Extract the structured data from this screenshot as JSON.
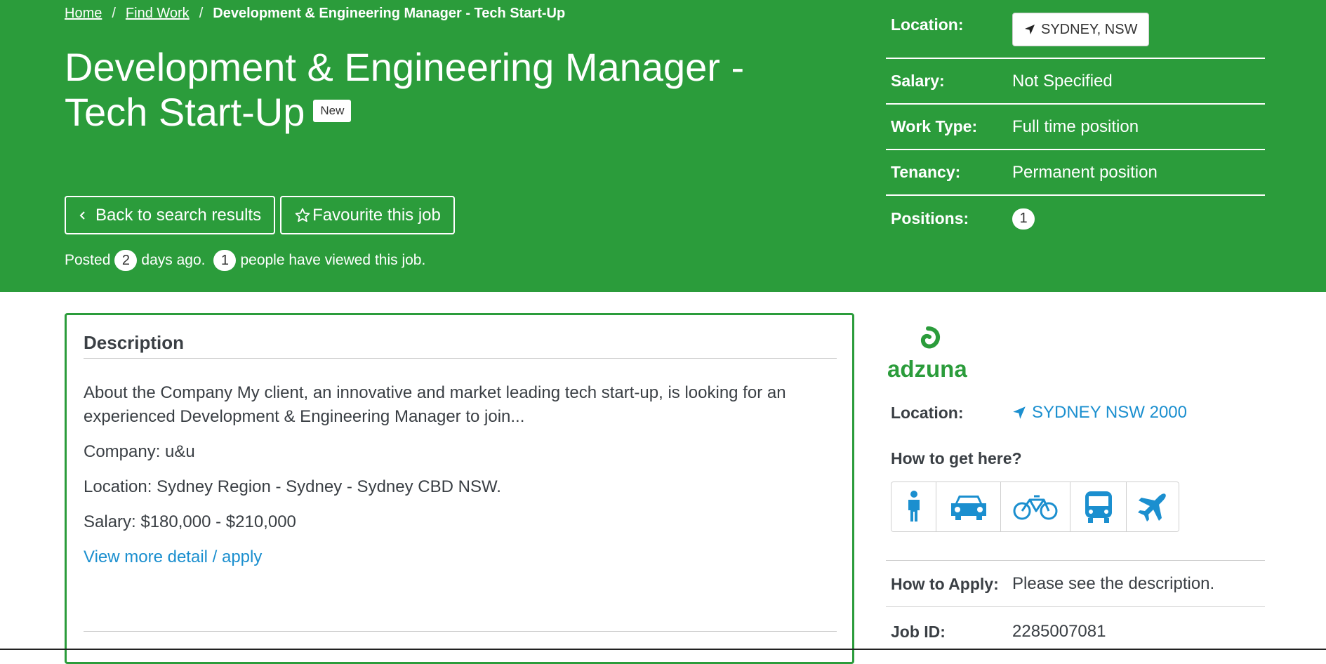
{
  "breadcrumb": {
    "home": "Home",
    "find_work": "Find Work",
    "current": "Development & Engineering Manager - Tech Start-Up",
    "separator": "/"
  },
  "job": {
    "title": "Development & Engineering Manager - Tech Start-Up",
    "badge": "New"
  },
  "buttons": {
    "back": "Back to search results",
    "favourite": "Favourite this job"
  },
  "posted": {
    "prefix": "Posted",
    "days": "2",
    "days_suffix": "days ago.",
    "views": "1",
    "views_suffix": "people have viewed this job."
  },
  "summary": {
    "location_label": "Location:",
    "location_value": "SYDNEY, NSW",
    "salary_label": "Salary:",
    "salary_value": "Not Specified",
    "work_type_label": "Work Type:",
    "work_type_value": "Full time position",
    "tenancy_label": "Tenancy:",
    "tenancy_value": "Permanent position",
    "positions_label": "Positions:",
    "positions_value": "1"
  },
  "description": {
    "heading": "Description",
    "paragraphs": [
      "About the Company My client, an innovative and market leading tech start-up, is looking for an experienced Development & Engineering Manager to join...",
      "Company: u&u",
      "Location: Sydney Region - Sydney - Sydney CBD NSW.",
      "Salary: $180,000 - $210,000"
    ],
    "more_link": "View more detail / apply"
  },
  "side": {
    "logo_text": "adzuna",
    "location_label": "Location:",
    "location_value": "SYDNEY NSW 2000",
    "how_to_get_here": "How to get here?",
    "transport_icons": [
      "walk-icon",
      "car-icon",
      "bicycle-icon",
      "bus-icon",
      "plane-icon"
    ],
    "how_to_apply_label": "How to Apply:",
    "how_to_apply_value": "Please see the description.",
    "job_id_label": "Job ID:",
    "job_id_value": "2285007081"
  },
  "colors": {
    "brand_green": "#2b9c3b",
    "link_blue": "#1b8fcf",
    "text_dark": "#3a3f44"
  }
}
